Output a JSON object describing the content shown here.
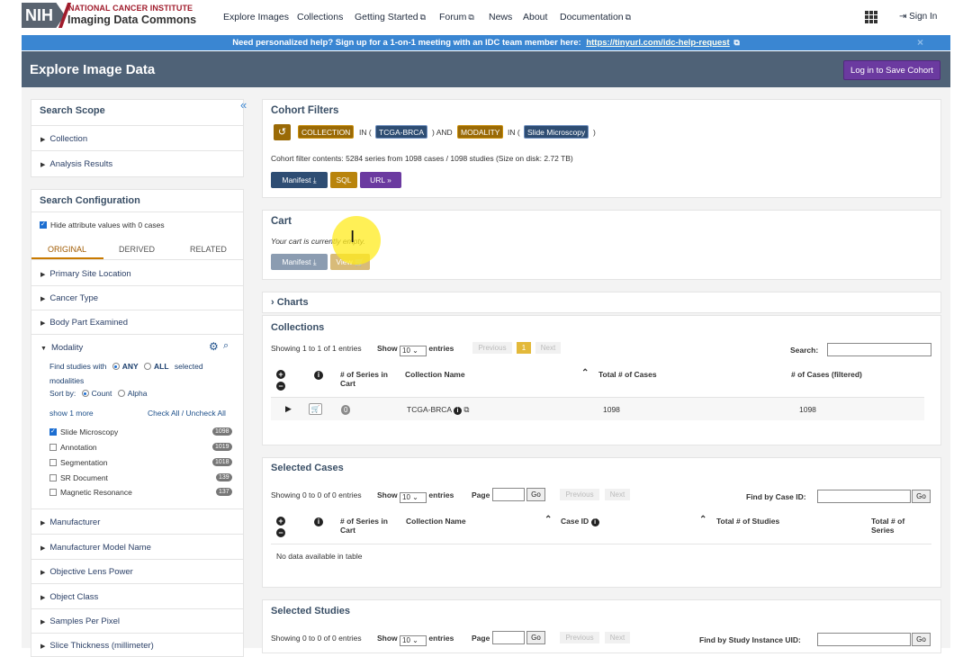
{
  "nav": {
    "logo_text": "NIH",
    "nci_text": "NATIONAL CANCER INSTITUTE",
    "idc_text": "Imaging Data Commons",
    "links": [
      "Explore Images",
      "Collections",
      "Getting Started",
      "Forum",
      "News",
      "About",
      "Documentation"
    ],
    "signin_label": "Sign In"
  },
  "banner": {
    "text": "Need personalized help? Sign up for a 1-on-1 meeting with an IDC team member here:",
    "link": "https://tinyurl.com/idc-help-request",
    "close": "×"
  },
  "header": {
    "title": "Explore Image Data",
    "save_button": "Log in to Save Cohort"
  },
  "sidebar": {
    "scope_title": "Search Scope",
    "scope_items": [
      "Collection",
      "Analysis Results"
    ],
    "config_title": "Search Configuration",
    "hide_zero_label": "Hide attribute values with 0 cases",
    "tabs": [
      "ORIGINAL",
      "DERIVED",
      "RELATED"
    ],
    "attributes_top": [
      "Primary Site Location",
      "Cancer Type",
      "Body Part Examined"
    ],
    "modality": {
      "label": "Modality",
      "find_studies": "Find studies with",
      "any": "ANY",
      "all": "ALL",
      "selected_mod": "selected",
      "modalities_word": "modalities",
      "sort_by": "Sort by:",
      "count": "Count",
      "alpha": "Alpha",
      "show_more": "show 1 more",
      "check_all": "Check All / Uncheck All",
      "items": [
        {
          "label": "Slide Microscopy",
          "count": "1098",
          "checked": true
        },
        {
          "label": "Annotation",
          "count": "1019",
          "checked": false
        },
        {
          "label": "Segmentation",
          "count": "1018",
          "checked": false
        },
        {
          "label": "SR Document",
          "count": "139",
          "checked": false
        },
        {
          "label": "Magnetic Resonance",
          "count": "137",
          "checked": false
        }
      ]
    },
    "attributes_bottom": [
      "Manufacturer",
      "Manufacturer Model Name",
      "Objective Lens Power",
      "Object Class",
      "Samples Per Pixel",
      "Slice Thickness (millimeter)"
    ]
  },
  "cohort": {
    "title": "Cohort Filters",
    "chip_collection": "COLLECTION",
    "in_word": "IN (",
    "chip_tcga": "TCGA-BRCA",
    "and_word": ") AND",
    "chip_modality": "MODALITY",
    "chip_slide": "Slide Microscopy",
    "close_paren": ")",
    "contents": "Cohort filter contents: 5284 series from 1098 cases / 1098 studies (Size on disk: 2.72 TB)",
    "manifest_btn": "Manifest",
    "sql_btn": "SQL",
    "url_btn": "URL"
  },
  "cart": {
    "title": "Cart",
    "empty_text": "Your cart is currently empty.",
    "manifest_btn": "Manifest",
    "view_btn": "View"
  },
  "charts": {
    "title": "Charts"
  },
  "collections": {
    "title": "Collections",
    "showing": "Showing 1 to 1 of 1 entries",
    "show": "Show",
    "entries": "entries",
    "page_size": "10",
    "previous": "Previous",
    "page": "1",
    "next": "Next",
    "search_label": "Search:",
    "headers": [
      "# of Series in Cart",
      "Collection Name",
      "Total # of Cases",
      "# of Cases (filtered)"
    ],
    "row": {
      "cart_count": "0",
      "name": "TCGA-BRCA",
      "total_cases": "1098",
      "filtered_cases": "1098"
    }
  },
  "selected_cases": {
    "title": "Selected Cases",
    "showing": "Showing 0 to 0 of 0 entries",
    "show": "Show",
    "entries": "entries",
    "page_size": "10",
    "page_label": "Page",
    "go": "Go",
    "previous": "Previous",
    "next": "Next",
    "find_label": "Find by Case ID:",
    "headers": [
      "# of Series in Cart",
      "Collection Name",
      "Case ID",
      "Total # of Studies",
      "Total # of Series"
    ],
    "empty": "No data available in table"
  },
  "selected_studies": {
    "title": "Selected Studies",
    "showing": "Showing 0 to 0 of 0 entries",
    "show": "Show",
    "entries": "entries",
    "page_size": "10",
    "page_label": "Page",
    "go": "Go",
    "previous": "Previous",
    "next": "Next",
    "find_label": "Find by Study Instance UID:"
  }
}
